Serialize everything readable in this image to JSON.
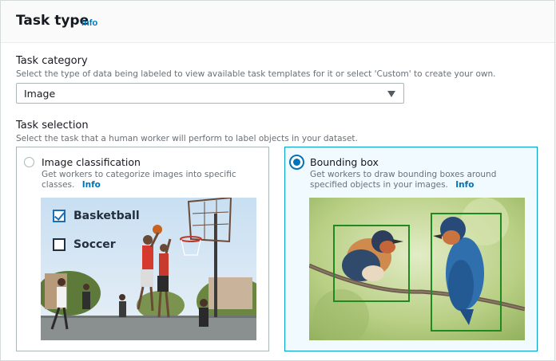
{
  "header": {
    "title": "Task type",
    "info": "Info"
  },
  "task_category": {
    "label": "Task category",
    "description": "Select the type of data being labeled to view available task templates for it or select 'Custom' to create your own.",
    "selected": "Image"
  },
  "task_selection": {
    "label": "Task selection",
    "description": "Select the task that a human worker will perform to label objects in your dataset.",
    "tiles": [
      {
        "title": "Image classification",
        "description": "Get workers to categorize images into specific classes.",
        "info": "Info",
        "selected": false,
        "example_labels": [
          {
            "text": "Basketball",
            "checked": true
          },
          {
            "text": "Soccer",
            "checked": false
          }
        ]
      },
      {
        "title": "Bounding box",
        "description": "Get workers to draw bounding boxes around specified objects in your images.",
        "info": "Info",
        "selected": true
      }
    ]
  },
  "colors": {
    "link": "#0073bb",
    "selected_border": "#00a1c9",
    "box_green": "#1f8a1f"
  }
}
